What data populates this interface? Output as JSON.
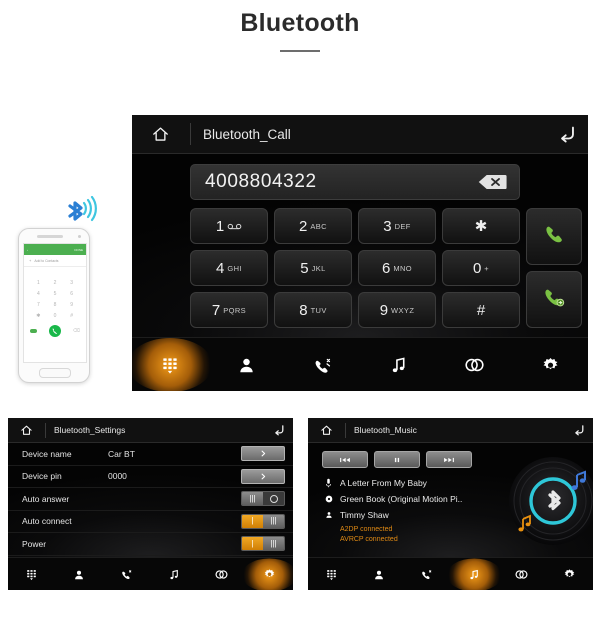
{
  "page": {
    "title": "Bluetooth"
  },
  "call_screen": {
    "home_icon": "home-icon",
    "title": "Bluetooth_Call",
    "back_icon": "back-icon",
    "number": "4008804322",
    "backspace_icon": "backspace-icon",
    "keys": [
      {
        "big": "1",
        "sub": "",
        "icon": "voicemail-icon"
      },
      {
        "big": "2",
        "sub": "ABC",
        "icon": ""
      },
      {
        "big": "3",
        "sub": "DEF",
        "icon": ""
      },
      {
        "big": "✱",
        "sub": "",
        "icon": ""
      },
      {
        "big": "4",
        "sub": "GHI",
        "icon": ""
      },
      {
        "big": "5",
        "sub": "JKL",
        "icon": ""
      },
      {
        "big": "6",
        "sub": "MNO",
        "icon": ""
      },
      {
        "big": "0",
        "sub": "+",
        "icon": ""
      },
      {
        "big": "7",
        "sub": "PQRS",
        "icon": ""
      },
      {
        "big": "8",
        "sub": "TUV",
        "icon": ""
      },
      {
        "big": "9",
        "sub": "WXYZ",
        "icon": ""
      },
      {
        "big": "#",
        "sub": "",
        "icon": ""
      }
    ],
    "dial_button_icon": "green-handset-icon",
    "transfer_button_icon": "green-handset-switch-icon",
    "tabs": [
      {
        "name": "keypad",
        "icon": "keypad-icon",
        "active": true
      },
      {
        "name": "contacts",
        "icon": "person-icon",
        "active": false
      },
      {
        "name": "call-history",
        "icon": "call-history-icon",
        "active": false
      },
      {
        "name": "music",
        "icon": "music-note-icon",
        "active": false
      },
      {
        "name": "pair",
        "icon": "link-icon",
        "active": false
      },
      {
        "name": "settings",
        "icon": "gear-icon",
        "active": false
      }
    ]
  },
  "settings_screen": {
    "home_icon": "home-icon",
    "title": "Bluetooth_Settings",
    "back_icon": "back-icon",
    "rows": [
      {
        "label": "Device name",
        "value": "Car BT",
        "control": "chevron",
        "chevron": "›"
      },
      {
        "label": "Device pin",
        "value": "0000",
        "control": "chevron",
        "chevron": "›"
      },
      {
        "label": "Auto answer",
        "value": "",
        "control": "toggle",
        "state": "off"
      },
      {
        "label": "Auto connect",
        "value": "",
        "control": "toggle",
        "state": "on"
      },
      {
        "label": "Power",
        "value": "",
        "control": "toggle",
        "state": "on"
      }
    ],
    "tabs": [
      {
        "name": "keypad",
        "icon": "keypad-icon",
        "active": false
      },
      {
        "name": "contacts",
        "icon": "person-icon",
        "active": false
      },
      {
        "name": "call-history",
        "icon": "call-history-icon",
        "active": false
      },
      {
        "name": "music",
        "icon": "music-note-icon",
        "active": false
      },
      {
        "name": "pair",
        "icon": "link-icon",
        "active": false
      },
      {
        "name": "settings",
        "icon": "gear-icon",
        "active": true
      }
    ]
  },
  "music_screen": {
    "home_icon": "home-icon",
    "title": "Bluetooth_Music",
    "back_icon": "back-icon",
    "transport": [
      {
        "name": "previous",
        "glyph": "⏮"
      },
      {
        "name": "pause",
        "glyph": "⏸"
      },
      {
        "name": "next",
        "glyph": "⏭"
      }
    ],
    "track": {
      "icon": "track-icon",
      "text": "A Letter From My Baby"
    },
    "album": {
      "icon": "album-disc-icon",
      "text": "Green Book (Original Motion Pi.."
    },
    "artist": {
      "icon": "person-icon",
      "text": "Timmy Shaw"
    },
    "status": [
      "A2DP connected",
      "AVRCP connected"
    ],
    "disc_icon": "bluetooth-disc-icon",
    "tabs": [
      {
        "name": "keypad",
        "icon": "keypad-icon",
        "active": false
      },
      {
        "name": "contacts",
        "icon": "person-icon",
        "active": false
      },
      {
        "name": "call-history",
        "icon": "call-history-icon",
        "active": false
      },
      {
        "name": "music",
        "icon": "music-note-icon",
        "active": true
      },
      {
        "name": "pair",
        "icon": "link-icon",
        "active": false
      },
      {
        "name": "settings",
        "icon": "gear-icon",
        "active": false
      }
    ]
  },
  "phone_mock": {
    "bluetooth_badge_icon": "bluetooth-signal-icon",
    "status_left": "‹",
    "status_right": "DONE",
    "add_contact_label": "Add to Contacts",
    "keys": [
      "1",
      "2",
      "3",
      "4",
      "5",
      "6",
      "7",
      "8",
      "9",
      "✱",
      "0",
      "#"
    ],
    "call_icon": "green-call-icon"
  },
  "colors": {
    "accent_orange": "#e8900f",
    "status_orange": "#e08a14",
    "call_green": "#7ac143",
    "bt_blue": "#2a7fd4",
    "bt_cyan": "#2ec7d8",
    "panel_black": "#000000"
  }
}
